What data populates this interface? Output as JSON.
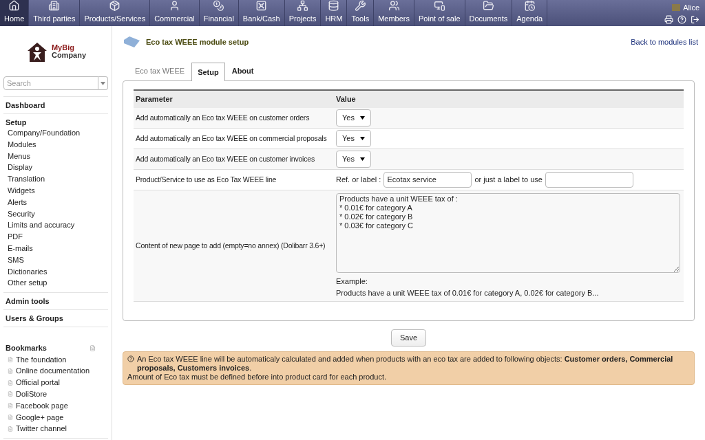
{
  "topmenu": [
    {
      "label": "Home",
      "selected": true
    },
    {
      "label": "Third parties",
      "selected": false
    },
    {
      "label": "Products/Services",
      "selected": false
    },
    {
      "label": "Commercial",
      "selected": false
    },
    {
      "label": "Financial",
      "selected": false
    },
    {
      "label": "Bank/Cash",
      "selected": false
    },
    {
      "label": "Projects",
      "selected": false
    },
    {
      "label": "HRM",
      "selected": false
    },
    {
      "label": "Tools",
      "selected": false
    },
    {
      "label": "Members",
      "selected": false
    },
    {
      "label": "Point of sale",
      "selected": false
    },
    {
      "label": "Documents",
      "selected": false
    },
    {
      "label": "Agenda",
      "selected": false
    }
  ],
  "user": {
    "name": "Alice"
  },
  "logo": {
    "line1": "MyBig",
    "line2": "Company"
  },
  "sidebar": {
    "search": {
      "placeholder": "Search"
    },
    "sections": [
      {
        "title": "Dashboard"
      },
      {
        "title": "Setup",
        "items": [
          "Company/Foundation",
          "Modules",
          "Menus",
          "Display",
          "Translation",
          "Widgets",
          "Alerts",
          "Security",
          "Limits and accuracy",
          "PDF",
          "E-mails",
          "SMS",
          "Dictionaries",
          "Other setup"
        ]
      },
      {
        "title": "Admin tools"
      },
      {
        "title": "Users & Groups"
      }
    ],
    "bookmarks": {
      "title": "Bookmarks",
      "items": [
        "The foundation",
        "Online documentation",
        "Official portal",
        "DoliStore",
        "Facebook page",
        "Google+ page",
        "Twitter channel"
      ]
    }
  },
  "page": {
    "title": "Eco tax WEEE module setup",
    "back_link": "Back to modules list"
  },
  "tabs": [
    {
      "label": "Eco tax WEEE",
      "selected": false
    },
    {
      "label": "Setup",
      "selected": true
    },
    {
      "label": "About",
      "selected": false
    }
  ],
  "table": {
    "columns": [
      "Parameter",
      "Value"
    ],
    "rows": [
      {
        "kind": "select",
        "label": "Add automatically an Eco tax WEEE on customer orders",
        "value": "Yes"
      },
      {
        "kind": "select",
        "label": "Add automatically an Eco tax WEEE on commercial proposals",
        "value": "Yes"
      },
      {
        "kind": "select",
        "label": "Add automatically an Eco tax WEEE on customer invoices",
        "value": "Yes"
      },
      {
        "kind": "ref",
        "label": "Product/Service to use as Eco Tax WEEE line",
        "ref_label": "Ref. or label :",
        "ref_value": "Ecotax service",
        "alt_label": "or just a label to use"
      },
      {
        "kind": "textarea",
        "label": "Content of new page to add (empty=no annex) (Dolibarr 3.6+)",
        "value": "Products have a unit WEEE tax of :\n* 0.01€ for category A\n* 0.02€ for category B\n* 0.03€ for category C",
        "example_title": "Example:",
        "example": "Products have a unit WEEE tax of 0.01€ for category A, 0.02€ for category B..."
      }
    ]
  },
  "save_button": "Save",
  "note": {
    "lines": [
      "An Eco tax WEEE line will be automaticaly calculated and added when products with an eco tax are added to following objects: **Customer orders, Commercial proposals, Customers invoices**.",
      "Amount of Eco tax must be defined before into product card for each product."
    ]
  }
}
